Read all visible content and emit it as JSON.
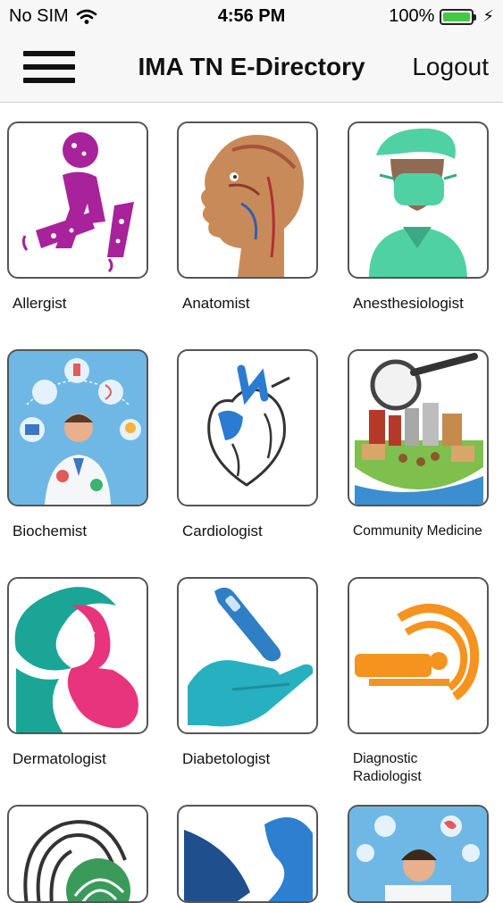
{
  "status_bar": {
    "carrier": "No SIM",
    "time": "4:56 PM",
    "battery": "100%"
  },
  "nav": {
    "title": "IMA TN E-Directory",
    "logout_label": "Logout"
  },
  "specialties": [
    {
      "label": "Allergist"
    },
    {
      "label": "Anatomist"
    },
    {
      "label": "Anesthesiologist"
    },
    {
      "label": "Biochemist"
    },
    {
      "label": "Cardiologist"
    },
    {
      "label": "Community Medicine"
    },
    {
      "label": "Dermatologist"
    },
    {
      "label": "Diabetologist"
    },
    {
      "label": "Diagnostic Radiologist"
    },
    {
      "label": ""
    },
    {
      "label": ""
    },
    {
      "label": ""
    }
  ],
  "colors": {
    "allergist": "#a8229c",
    "cardiologist_blue": "#2a7bd1",
    "anesthesia_green": "#4fd1a3",
    "biochem_bg": "#6fb8e6",
    "derm_teal": "#1aa597",
    "derm_pink": "#e8347c",
    "diabet_teal": "#27b0c0",
    "radiology_orange": "#f5931f"
  }
}
